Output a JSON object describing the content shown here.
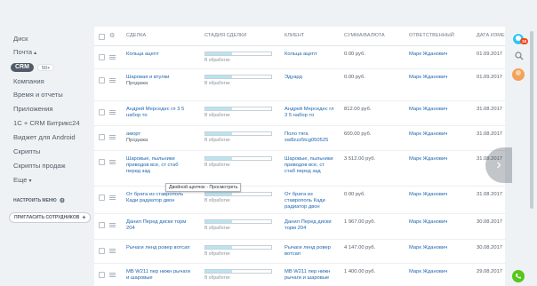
{
  "sidebar": {
    "items": [
      {
        "label": "Диск"
      },
      {
        "label": "Почта"
      },
      {
        "label": "CRM",
        "badge": "50+"
      },
      {
        "label": "Компания"
      },
      {
        "label": "Время и отчеты"
      },
      {
        "label": "Приложения"
      },
      {
        "label": "1С + CRM Битрикс24"
      },
      {
        "label": "Виджет для Android"
      },
      {
        "label": "Скрипты"
      },
      {
        "label": "Скрипты продаж"
      },
      {
        "label": "Еще"
      }
    ],
    "settings_label": "НАСТРОИТЬ МЕНЮ",
    "invite_label": "ПРИГЛАСИТЬ СОТРУДНИКОВ"
  },
  "table": {
    "headers": {
      "deal": "СДЕЛКА",
      "stage": "СТАДИЯ СДЕЛКИ",
      "client": "КЛИЕНТ",
      "sum": "СУММА/ВАЛЮТА",
      "responsible": "ОТВЕТСТВЕННЫЙ",
      "date": "ДАТА ИЗМЕН"
    },
    "rows": [
      {
        "deal": "Кольца ацеnт",
        "deal_sub": "",
        "stage": "В обработке",
        "client": "Кольца ацеnт",
        "sum": "0.00 руб.",
        "responsible": "Марк Жданович",
        "date": "01.09.2017"
      },
      {
        "deal": "Шаровая и втулки",
        "deal_sub": "Продажа",
        "stage": "В обработке",
        "client": "Эдуард",
        "sum": "0.00 руб.",
        "responsible": "Марк Жданович",
        "date": "01.09.2017"
      },
      {
        "deal": "Андрей Мерседес гл 3 5 набор то",
        "deal_sub": "",
        "stage": "В обработке",
        "client": "Андрей Мерседес гл 3 5 набор то",
        "sum": "812.00 руб.",
        "responsible": "Марк Жданович",
        "date": "31.08.2017"
      },
      {
        "deal": "аморт",
        "deal_sub": "Продажа",
        "stage": "В обработке",
        "client": "Поло тяга xw8zzz5tcg050525",
        "sum": "600.00 руб.",
        "responsible": "Марк Жданович",
        "date": "31.08.2017"
      },
      {
        "deal": "Шаровые, пыльники приводов все, ст стаб перед зад",
        "deal_sub": "",
        "stage": "В обработке",
        "client": "Шаровые, пыльники приводов все, ст стаб перед зад",
        "sum": "3 512.00 руб.",
        "responsible": "Марк Жданович",
        "date": "31.08.2017"
      },
      {
        "deal": "От брата из ставрополь Кади радиатор двон",
        "deal_sub": "",
        "stage": "В обработке",
        "client": "От брата из ставрополь Кади радиатор двон",
        "sum": "0.00 руб.",
        "responsible": "Марк Жданович",
        "date": "31.08.2017"
      },
      {
        "deal": "Данил Перед диски торм 204",
        "deal_sub": "",
        "stage": "В обработке",
        "client": "Данил Перед диски торм 204",
        "sum": "1 967.00 руб.",
        "responsible": "Марк Жданович",
        "date": "30.08.2017"
      },
      {
        "deal": "Рычаги ленд ровер вотсап",
        "deal_sub": "",
        "stage": "В обработке",
        "client": "Рычаги ленд ровер вотсап",
        "sum": "4 147.00 руб.",
        "responsible": "Марк Жданович",
        "date": "30.08.2017"
      },
      {
        "deal": "MB W211 пер нижн рычаги и шаровые",
        "deal_sub": "",
        "stage": "В обработке",
        "client": "MB W211 пер нижн рычаги и шаровые",
        "sum": "1 400.00 руб.",
        "responsible": "Марк Жданович",
        "date": "29.08.2017"
      }
    ]
  },
  "tooltip": "Двойной щелчок - Просмотреть",
  "rail": {
    "notification_count": "19"
  },
  "colors": {
    "stage_fill": "#b9e4f2",
    "link": "#2067b0",
    "phone": "#55c71d"
  },
  "icons": [
    "gear-icon",
    "menu-icon",
    "search-icon",
    "plus-icon",
    "phone-icon",
    "chevron-right-icon"
  ]
}
